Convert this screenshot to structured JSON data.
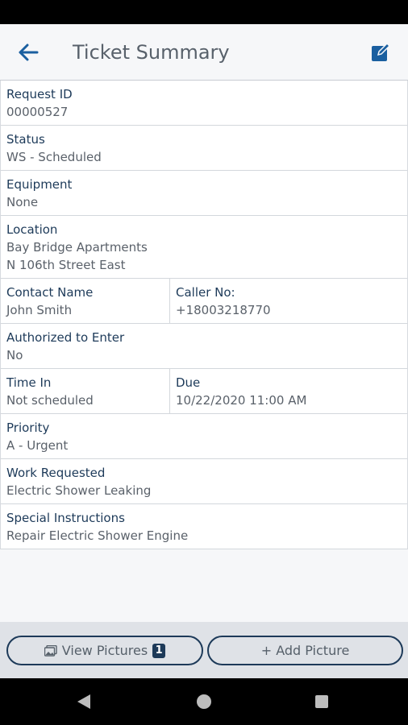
{
  "appbar": {
    "title": "Ticket Summary"
  },
  "fields": {
    "request_id": {
      "label": "Request ID",
      "value": "00000527"
    },
    "status": {
      "label": "Status",
      "value": "WS - Scheduled"
    },
    "equipment": {
      "label": "Equipment",
      "value": "None"
    },
    "location": {
      "label": "Location",
      "line1": "Bay Bridge Apartments",
      "line2": "N 106th Street East"
    },
    "contact_name": {
      "label": "Contact Name",
      "value": "John Smith"
    },
    "caller_no": {
      "label": "Caller No:",
      "value": "+18003218770"
    },
    "authorized": {
      "label": "Authorized to Enter",
      "value": "No"
    },
    "time_in": {
      "label": "Time In",
      "value": "Not scheduled"
    },
    "due": {
      "label": "Due",
      "value": "10/22/2020 11:00 AM"
    },
    "priority": {
      "label": "Priority",
      "value": "A - Urgent"
    },
    "work_requested": {
      "label": "Work Requested",
      "value": "Electric Shower Leaking"
    },
    "special_instructions": {
      "label": "Special Instructions",
      "value": "Repair Electric Shower Engine"
    }
  },
  "buttons": {
    "view_pictures": "View Pictures",
    "picture_count": "1",
    "add_picture": "+ Add Picture"
  },
  "colors": {
    "label": "#1d3a59",
    "value": "#5a616a",
    "accent": "#1a5fa0"
  }
}
